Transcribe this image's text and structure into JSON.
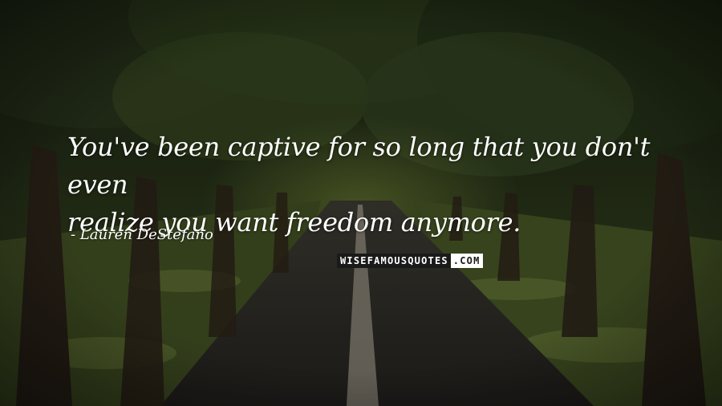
{
  "quote": {
    "text_line1": "You've been captive for so long that you don't even",
    "text_line2": "realize you want freedom anymore."
  },
  "author": "- Lauren DeStefano",
  "watermark": {
    "main": "WISEFAMOUSQUOTES",
    "tld": ".COM"
  },
  "colors": {
    "text": "#ffffff",
    "foliage": "#2f3d1b",
    "road": "#2b2926",
    "grass": "#4a5a26"
  }
}
